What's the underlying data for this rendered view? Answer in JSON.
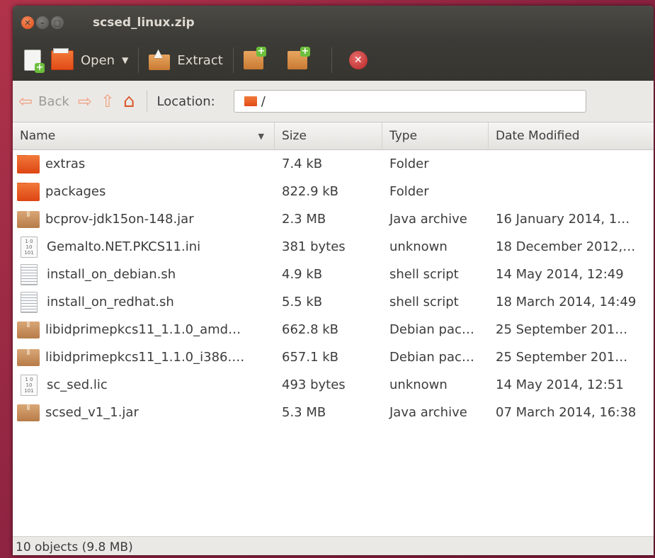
{
  "window": {
    "title": "scsed_linux.zip"
  },
  "toolbar": {
    "open_label": "Open",
    "extract_label": "Extract"
  },
  "locationbar": {
    "back_label": "Back",
    "location_label": "Location:",
    "location_value": "/"
  },
  "columns": {
    "name": "Name",
    "size": "Size",
    "type": "Type",
    "date": "Date Modified"
  },
  "files": [
    {
      "icon": "folder-icon",
      "name": "extras",
      "size": "7.4 kB",
      "type": "Folder",
      "date": ""
    },
    {
      "icon": "folder-icon",
      "name": "packages",
      "size": "822.9 kB",
      "type": "Folder",
      "date": ""
    },
    {
      "icon": "package-icon",
      "name": "bcprov-jdk15on-148.jar",
      "size": "2.3 MB",
      "type": "Java archive",
      "date": "16 January 2014, 1…"
    },
    {
      "icon": "binary-file-icon",
      "name": "Gemalto.NET.PKCS11.ini",
      "size": "381 bytes",
      "type": "unknown",
      "date": "18 December 2012,…"
    },
    {
      "icon": "script-file-icon",
      "name": "install_on_debian.sh",
      "size": "4.9 kB",
      "type": "shell script",
      "date": "14 May 2014, 12:49"
    },
    {
      "icon": "script-file-icon",
      "name": "install_on_redhat.sh",
      "size": "5.5 kB",
      "type": "shell script",
      "date": "18 March 2014, 14:49"
    },
    {
      "icon": "package-icon",
      "name": "libidprimepkcs11_1.1.0_amd…",
      "size": "662.8 kB",
      "type": "Debian pac…",
      "date": "25 September 201…"
    },
    {
      "icon": "package-icon",
      "name": "libidprimepkcs11_1.1.0_i386.…",
      "size": "657.1 kB",
      "type": "Debian pac…",
      "date": "25 September 201…"
    },
    {
      "icon": "binary-file-icon",
      "name": "sc_sed.lic",
      "size": "493 bytes",
      "type": "unknown",
      "date": "14 May 2014, 12:51"
    },
    {
      "icon": "package-icon",
      "name": "scsed_v1_1.jar",
      "size": "5.3 MB",
      "type": "Java archive",
      "date": "07 March 2014, 16:38"
    }
  ],
  "status": {
    "text": "10 objects (9.8 MB)"
  }
}
